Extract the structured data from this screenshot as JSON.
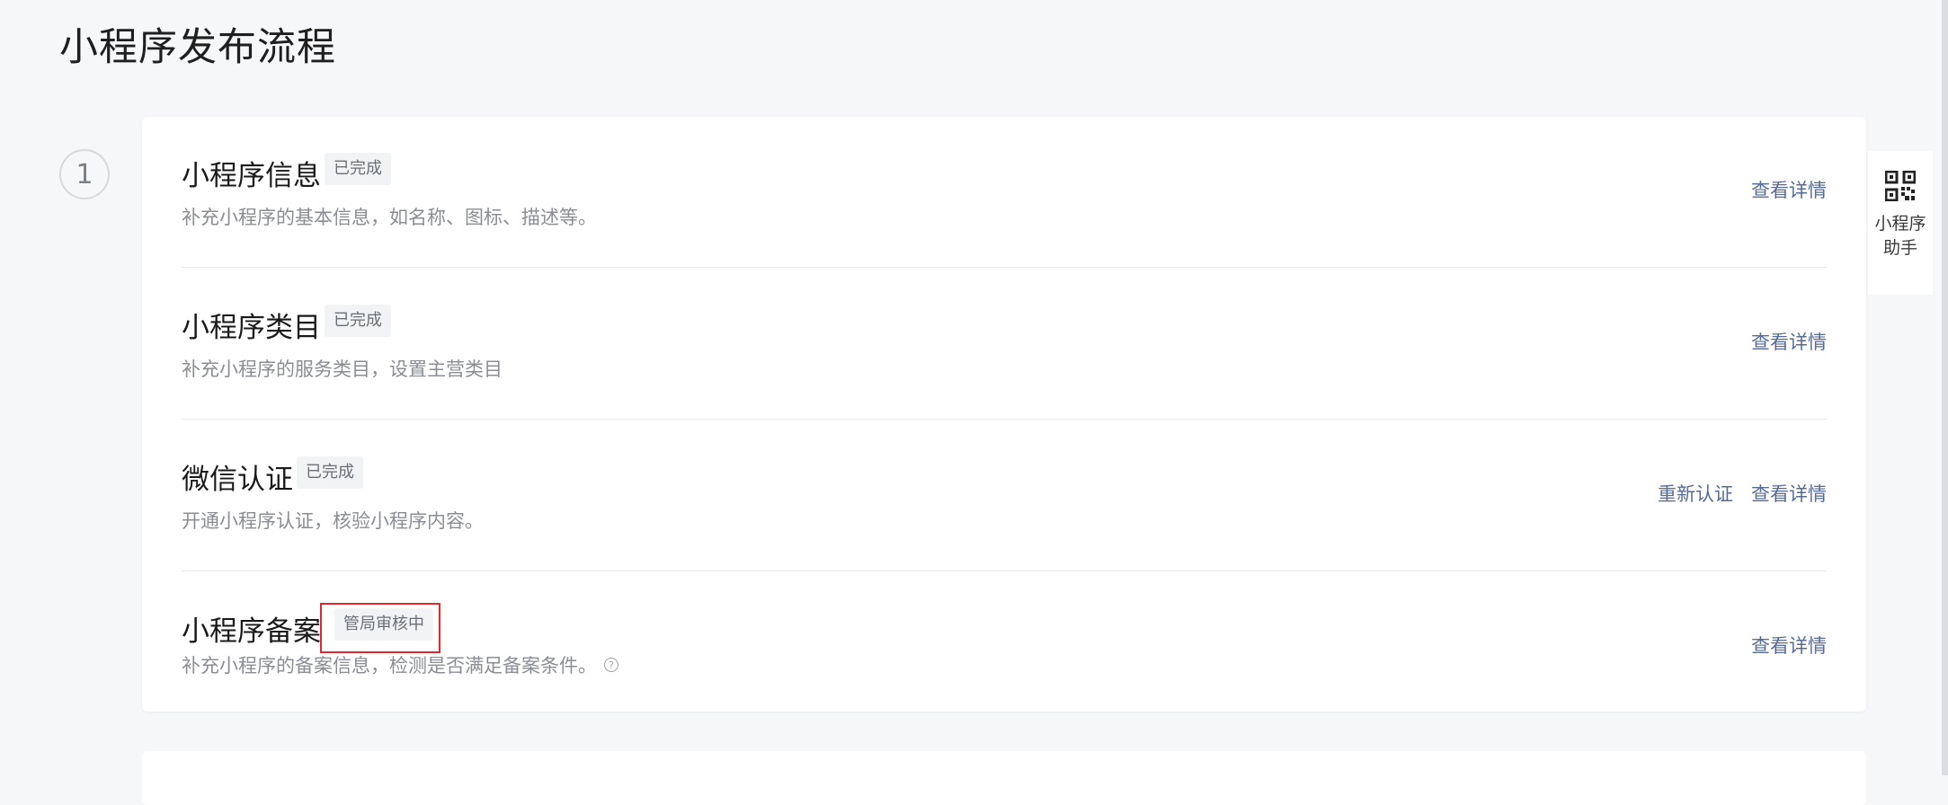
{
  "page": {
    "title": "小程序发布流程"
  },
  "step": {
    "number": "1"
  },
  "items": [
    {
      "title": "小程序信息",
      "status": "已完成",
      "description": "补充小程序的基本信息，如名称、图标、描述等。",
      "actions": [
        "查看详情"
      ]
    },
    {
      "title": "小程序类目",
      "status": "已完成",
      "description": "补充小程序的服务类目，设置主营类目",
      "actions": [
        "查看详情"
      ]
    },
    {
      "title": "微信认证",
      "status": "已完成",
      "description": "开通小程序认证，核验小程序内容。",
      "actions": [
        "重新认证",
        "查看详情"
      ]
    },
    {
      "title": "小程序备案",
      "status": "管局审核中",
      "description": "补充小程序的备案信息，检测是否满足备案条件。",
      "actions": [
        "查看详情"
      ]
    }
  ],
  "assistant": {
    "label": "小程序助手",
    "icon": "qrcode-icon"
  },
  "colors": {
    "link": "#576b95",
    "highlight": "#e0282e",
    "background": "#f6f7f9"
  }
}
